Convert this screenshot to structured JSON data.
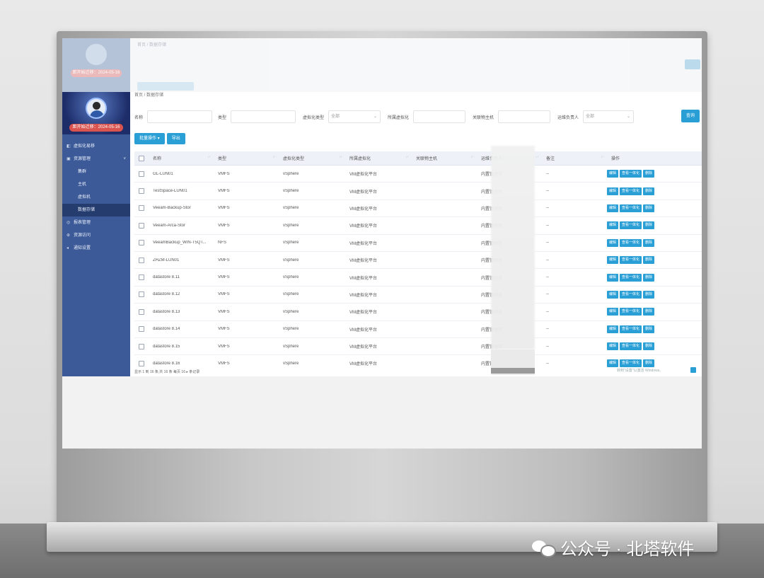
{
  "sidebar": {
    "date": "距开始迁移：2024-05-16",
    "items": [
      {
        "label": "虚拟化易移",
        "icon": "dashboard-icon",
        "sub": false,
        "active": false
      },
      {
        "label": "资源管理",
        "icon": "folder-icon",
        "sub": false,
        "active": false,
        "chevron": "˅"
      },
      {
        "label": "集群",
        "sub": true,
        "active": false
      },
      {
        "label": "主机",
        "sub": true,
        "active": false
      },
      {
        "label": "虚拟机",
        "sub": true,
        "active": false
      },
      {
        "label": "数据存储",
        "sub": true,
        "active": true
      },
      {
        "label": "报表管理",
        "icon": "report-icon",
        "sub": false,
        "active": false
      },
      {
        "label": "资源访问",
        "icon": "link-icon",
        "sub": false,
        "active": false
      },
      {
        "label": "通知设置",
        "icon": "bell-icon",
        "sub": false,
        "active": false
      }
    ]
  },
  "breadcrumb": "首页 / 数据存储",
  "filters": {
    "name_label": "名称",
    "type_label": "类型",
    "platform_type_label": "虚拟化类型",
    "platform_type_value": "全部",
    "platform_label": "所属虚拟化",
    "host_label": "关联物主机",
    "owner_label": "运维负责人",
    "owner_value": "全部",
    "search": "查询"
  },
  "actions": {
    "batch": "批量操作 ▾",
    "export": "导出"
  },
  "table": {
    "headers": [
      "名称",
      "类型",
      "虚拟化类型",
      "所属虚拟化",
      "关联物主机",
      "运维负责人",
      "备注",
      "操作"
    ],
    "op_labels": [
      "编辑",
      "查看一体化",
      "删除"
    ],
    "rows": [
      [
        "GL-LUN01",
        "VMFS",
        "vSphere",
        "VM虚拟化平台",
        "",
        "内置管理员",
        "--"
      ],
      [
        "TestSpace-LUN01",
        "VMFS",
        "vSphere",
        "VM虚拟化平台",
        "",
        "内置管理员",
        "--"
      ],
      [
        "Veeam-Backup-Stor",
        "VMFS",
        "vSphere",
        "VM虚拟化平台",
        "",
        "内置管理员",
        "--"
      ],
      [
        "Veeam-Arca-Stor",
        "VMFS",
        "vSphere",
        "VM虚拟化平台",
        "",
        "内置管理员",
        "--"
      ],
      [
        "VeeamBackup_WIN-T5QT...",
        "NFS",
        "vSphere",
        "VM虚拟化平台",
        "",
        "内置管理员",
        "--"
      ],
      [
        "ZHZM-LUN01",
        "VMFS",
        "vSphere",
        "VM虚拟化平台",
        "",
        "内置管理员",
        "--"
      ],
      [
        "datastore 8.11",
        "VMFS",
        "vSphere",
        "VM虚拟化平台",
        "",
        "内置管理员",
        "--"
      ],
      [
        "datastore 8.12",
        "VMFS",
        "vSphere",
        "VM虚拟化平台",
        "",
        "内置管理员",
        "--"
      ],
      [
        "datastore 8.13",
        "VMFS",
        "vSphere",
        "VM虚拟化平台",
        "",
        "内置管理员",
        "--"
      ],
      [
        "datastore 8.14",
        "VMFS",
        "vSphere",
        "VM虚拟化平台",
        "",
        "内置管理员",
        "--"
      ],
      [
        "datastore 8.15",
        "VMFS",
        "vSphere",
        "VM虚拟化平台",
        "",
        "内置管理员",
        "--"
      ],
      [
        "datastore 8.16",
        "VMFS",
        "vSphere",
        "VM虚拟化平台",
        "",
        "内置管理员",
        "--"
      ]
    ]
  },
  "pagination": "显示 1 到 16 条,共 16 条   每页  16   ▸   条记录",
  "windows_notice": "转到\"设置\"以激活 Windows。",
  "watermark": "公众号 · 北塔软件",
  "colors": {
    "sidebar": "#3c5a97",
    "primary": "#2a9fd6",
    "danger": "#d9534f"
  }
}
